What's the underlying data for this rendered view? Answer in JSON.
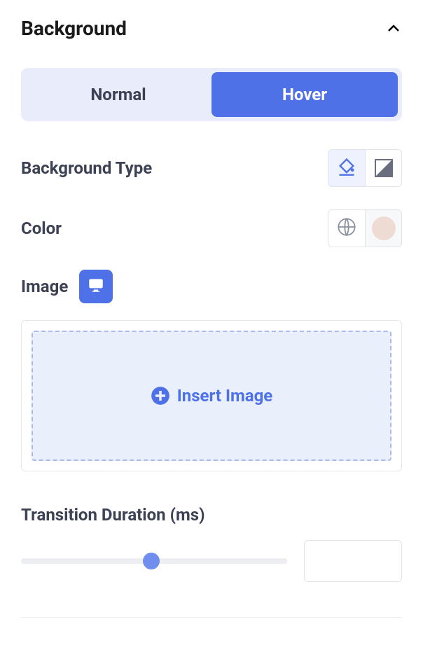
{
  "section": {
    "title": "Background"
  },
  "tabs": {
    "normal": "Normal",
    "hover": "Hover"
  },
  "labels": {
    "backgroundType": "Background Type",
    "color": "Color",
    "image": "Image",
    "transitionDuration": "Transition Duration (ms)"
  },
  "dropzone": {
    "text": "Insert Image"
  },
  "colorSwatch": "#eedcd4",
  "transition": {
    "value": ""
  }
}
